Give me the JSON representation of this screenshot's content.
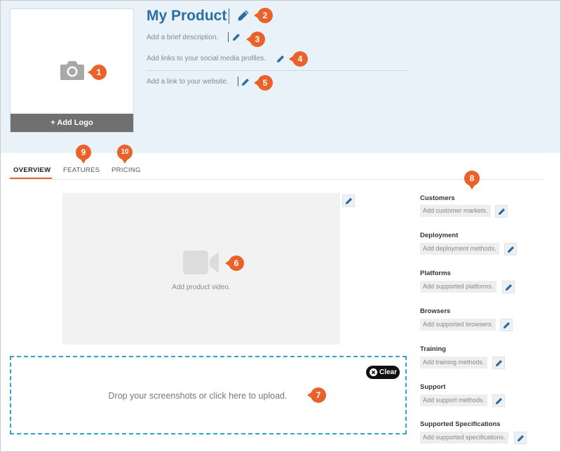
{
  "product": {
    "title": "My Product",
    "add_logo_label": "+ Add Logo",
    "description_placeholder": "Add a brief description.",
    "social_placeholder": "Add links to your social media profiles.",
    "website_placeholder": "Add a link to your website."
  },
  "tabs": [
    {
      "label": "OVERVIEW",
      "active": true
    },
    {
      "label": "FEATURES",
      "active": false
    },
    {
      "label": "PRICING",
      "active": false
    }
  ],
  "video": {
    "placeholder": "Add product video."
  },
  "upload": {
    "text": "Drop your screenshots or click here to upload.",
    "clear_label": "Clear"
  },
  "sidebar": {
    "sections": [
      {
        "title": "Customers",
        "placeholder": "Add customer markets."
      },
      {
        "title": "Deployment",
        "placeholder": "Add deployment methods."
      },
      {
        "title": "Platforms",
        "placeholder": "Add supported platforms."
      },
      {
        "title": "Browsers",
        "placeholder": "Add supported browsers."
      },
      {
        "title": "Training",
        "placeholder": "Add training methods."
      },
      {
        "title": "Support",
        "placeholder": "Add support methods."
      },
      {
        "title": "Supported Specifications",
        "placeholder": "Add supported specifications."
      }
    ]
  },
  "callouts": [
    "1",
    "2",
    "3",
    "4",
    "5",
    "6",
    "7",
    "8",
    "9",
    "10"
  ],
  "colors": {
    "accent": "#e8622a",
    "brand": "#2b6ea3",
    "header_bg": "#e9f2f8",
    "dropzone_border": "#2fa6c9"
  },
  "icons": {
    "logo": "camera-icon",
    "video": "video-camera-icon",
    "edit": "pencil-icon",
    "clear": "close-circle-icon"
  }
}
